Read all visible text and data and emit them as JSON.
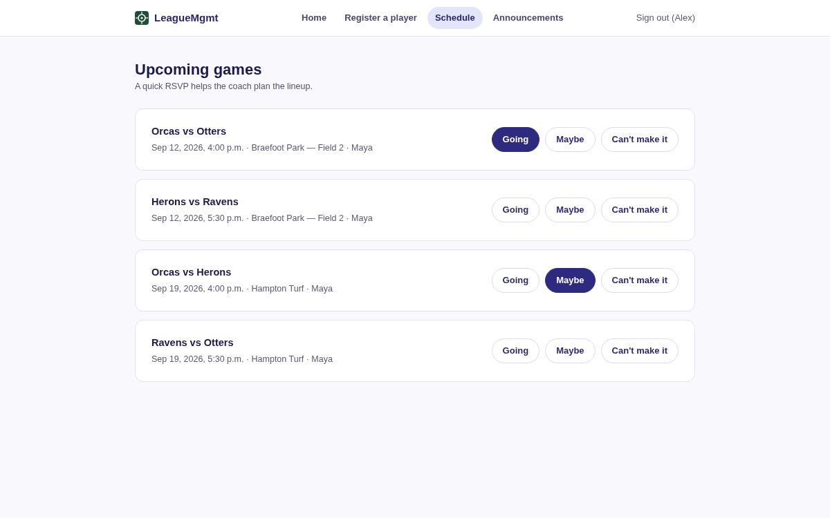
{
  "header": {
    "brand": "LeagueMgmt",
    "nav": [
      {
        "label": "Home",
        "selected": false
      },
      {
        "label": "Register a player",
        "selected": false
      },
      {
        "label": "Schedule",
        "selected": true
      },
      {
        "label": "Announcements",
        "selected": false
      }
    ],
    "sign_out": "Sign out (Alex)"
  },
  "page": {
    "title": "Upcoming games",
    "subtitle": "A quick RSVP helps the coach plan the lineup."
  },
  "games": [
    {
      "title": "Orcas vs Otters",
      "details": "Sep 12, 2026, 4:00 p.m. · Braefoot Park — Field 2 · Maya",
      "rsvp": [
        {
          "label": "Going",
          "selected": true
        },
        {
          "label": "Maybe",
          "selected": false
        },
        {
          "label": "Can't make it",
          "selected": false
        }
      ]
    },
    {
      "title": "Herons vs Ravens",
      "details": "Sep 12, 2026, 5:30 p.m. · Braefoot Park — Field 2 · Maya",
      "rsvp": [
        {
          "label": "Going",
          "selected": false
        },
        {
          "label": "Maybe",
          "selected": false
        },
        {
          "label": "Can't make it",
          "selected": false
        }
      ]
    },
    {
      "title": "Orcas vs Herons",
      "details": "Sep 19, 2026, 4:00 p.m. · Hampton Turf · Maya",
      "rsvp": [
        {
          "label": "Going",
          "selected": false
        },
        {
          "label": "Maybe",
          "selected": true
        },
        {
          "label": "Can't make it",
          "selected": false
        }
      ]
    },
    {
      "title": "Ravens vs Otters",
      "details": "Sep 19, 2026, 5:30 p.m. · Hampton Turf · Maya",
      "rsvp": [
        {
          "label": "Going",
          "selected": false
        },
        {
          "label": "Maybe",
          "selected": false
        },
        {
          "label": "Can't make it",
          "selected": false
        }
      ]
    }
  ]
}
